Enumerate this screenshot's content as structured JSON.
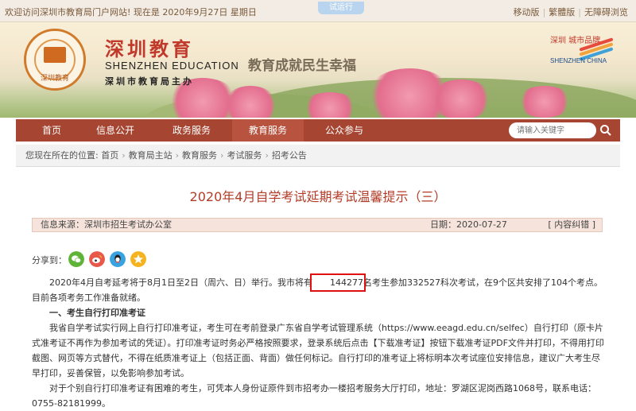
{
  "topbar": {
    "welcome": "欢迎访问深圳市教育局门户网站! 现在是 2020年9月27日 星期日",
    "trial": "试运行",
    "links": [
      "移动版",
      "繁體版",
      "无障碍浏览"
    ]
  },
  "header": {
    "seal_text": "深圳教育",
    "brand_cn": "深圳教育",
    "brand_en": "SHENZHEN EDUCATION",
    "brand_sub": "深圳市教育局主办",
    "slogan": "教育成就民生幸福",
    "sz_logo_cn": "深圳 城市品牌",
    "sz_logo_en": "SHENZHEN CHINA"
  },
  "nav": {
    "items": [
      "首页",
      "信息公开",
      "政务服务",
      "教育服务",
      "公众参与"
    ],
    "search_placeholder": "请输入关键字"
  },
  "breadcrumb": {
    "prefix": "您现在所在的位置:",
    "items": [
      "首页",
      "教育局主站",
      "教育服务",
      "考试服务",
      "招考公告"
    ]
  },
  "article": {
    "title": "2020年4月自学考试延期考试温馨提示（三）",
    "source": "信息来源：深圳市招生考试办公室",
    "date": "日期：2020-07-27",
    "correction": "[ 内容纠错 ]",
    "share_label": "分享到：",
    "p1_pre": "2020年4月自考延考将于8月1日至2日（周六、日）举行。我市将有",
    "p1_highlight": "144277",
    "p1_post": "名考生参加332527科次考试，在9个区共安排了104个考点。目前各项考务工作准备就绪。",
    "h1": "一、考生自行打印准考证",
    "p2": "我省自学考试实行网上自行打印准考证，考生可在考前登录广东省自学考试管理系统（https://www.eeagd.edu.cn/selfec）自行打印（原卡片式准考证不再作为参加考试的凭证）。打印准考证时务必严格按照要求，登录系统后点击【下载准考证】按钮下载准考证PDF文件并打印，不得用打印截图、网页等方式替代，不得在纸质准考证上（包括正面、背面）做任何标记。自行打印的准考证上将标明本次考试座位安排信息，建议广大考生尽早打印，妥善保管，以免影响参加考试。",
    "p3": "对于个别自行打印准考证有困难的考生，可凭本人身份证原件到市招考办一楼招考服务大厅打印，地址：罗湖区泥岗西路1068号，联系电话：0755-82181999。"
  },
  "colors": {
    "nav_bg": "#a64632",
    "title": "#b23c27",
    "highlight_box": "#e01010"
  }
}
